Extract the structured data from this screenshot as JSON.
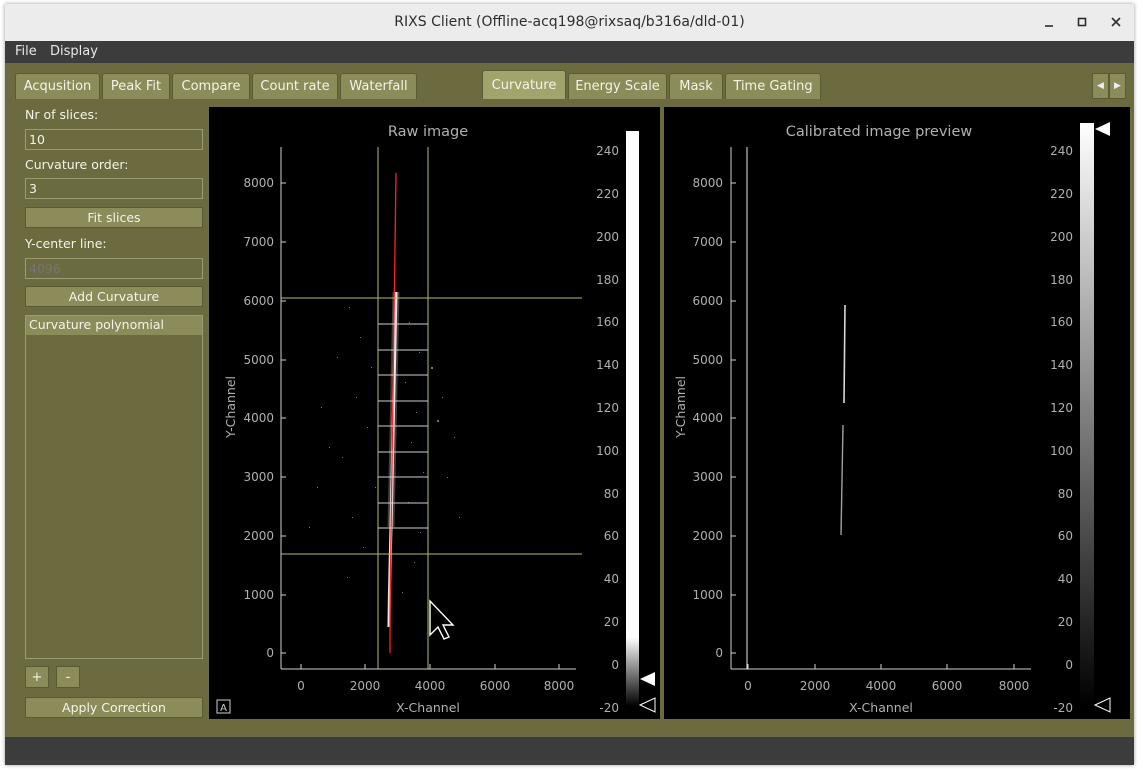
{
  "window": {
    "title": "RIXS Client (Offline-acq198@rixsaq/b316a/dld-01)"
  },
  "menu": {
    "items": [
      "File",
      "Display"
    ]
  },
  "tabs_left": [
    "Acqusition",
    "Peak Fit",
    "Compare",
    "Count rate",
    "Waterfall"
  ],
  "tabs_right": [
    "Curvature",
    "Energy Scale",
    "Mask",
    "Time Gating"
  ],
  "active_tab": "Curvature",
  "left_panel": {
    "nr_slices_label": "Nr of slices:",
    "nr_slices_value": "10",
    "curvature_order_label": "Curvature order:",
    "curvature_order_value": "3",
    "fit_slices_button": "Fit slices",
    "y_center_label": "Y-center line:",
    "y_center_placeholder": "4096",
    "add_curvature_button": "Add Curvature",
    "list_header": "Curvature polynomial",
    "plus_button": "+",
    "minus_button": "-",
    "apply_correction_button": "Apply Correction"
  },
  "raw_plot": {
    "title": "Raw image",
    "xlabel": "X-Channel",
    "ylabel": "Y-Channel",
    "autoscale_button": "A",
    "x_ticks": [
      "0",
      "2000",
      "4000",
      "6000",
      "8000"
    ],
    "y_ticks": [
      "0",
      "1000",
      "2000",
      "3000",
      "4000",
      "5000",
      "6000",
      "7000",
      "8000"
    ],
    "colorbar_ticks": [
      "-20",
      "0",
      "20",
      "40",
      "60",
      "80",
      "100",
      "120",
      "140",
      "160",
      "180",
      "200",
      "220",
      "240"
    ]
  },
  "calib_plot": {
    "title": "Calibrated image preview",
    "xlabel": "X-Channel",
    "ylabel": "Y-Channel",
    "x_ticks": [
      "0",
      "2000",
      "4000",
      "6000",
      "8000"
    ],
    "y_ticks": [
      "0",
      "1000",
      "2000",
      "3000",
      "4000",
      "5000",
      "6000",
      "7000",
      "8000"
    ],
    "colorbar_ticks": [
      "-20",
      "0",
      "20",
      "40",
      "60",
      "80",
      "100",
      "120",
      "140",
      "160",
      "180",
      "200",
      "220",
      "240"
    ]
  },
  "colors": {
    "window_bg": "#6b6b3f",
    "guide_lines": "#b8b86a",
    "curve": "#ff2020",
    "plot_bg": "#000000"
  }
}
